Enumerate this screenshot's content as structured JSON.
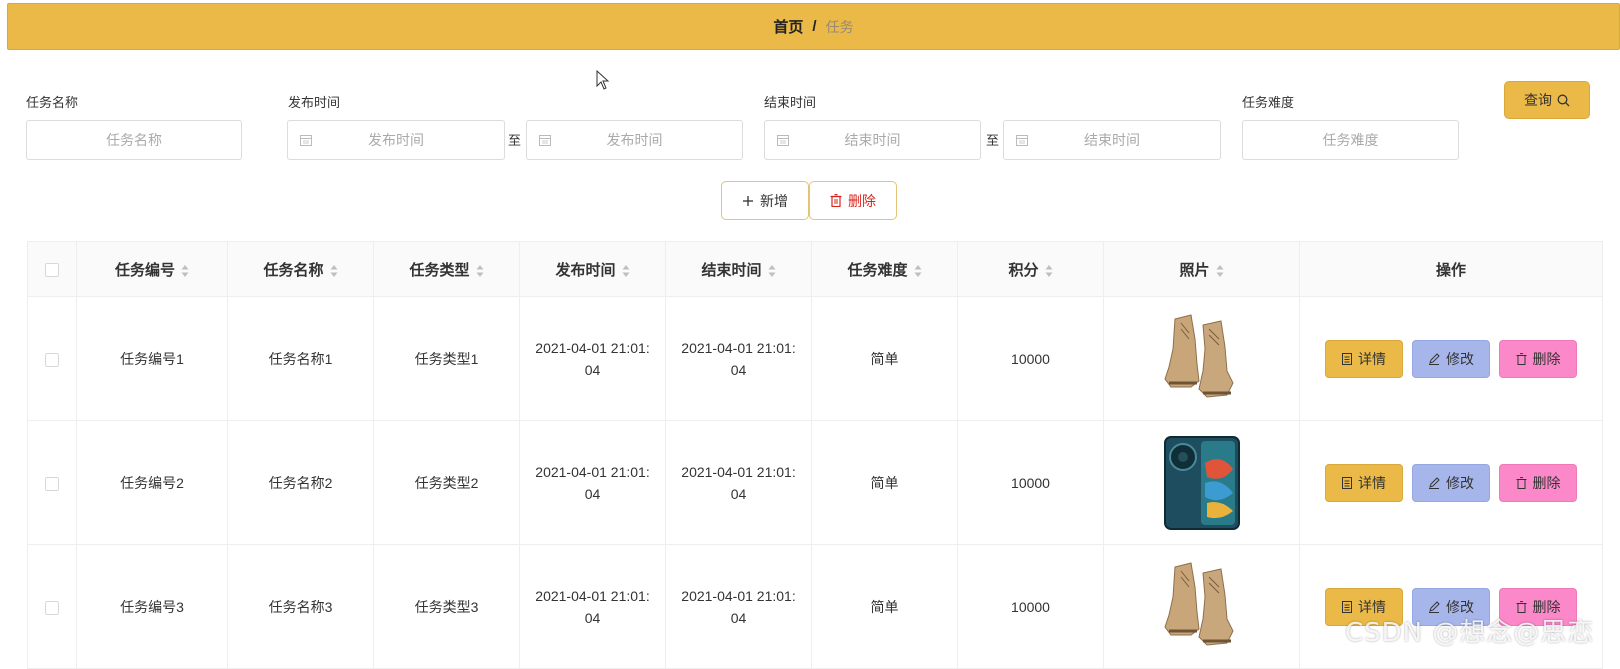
{
  "breadcrumb": {
    "home": "首页",
    "separator": "/",
    "current": "任务"
  },
  "filters": {
    "task_name": {
      "label": "任务名称",
      "placeholder": "任务名称"
    },
    "publish_time": {
      "label": "发布时间",
      "start_placeholder": "发布时间",
      "end_placeholder": "发布时间",
      "to": "至"
    },
    "end_time": {
      "label": "结束时间",
      "start_placeholder": "结束时间",
      "end_placeholder": "结束时间",
      "to": "至"
    },
    "difficulty": {
      "label": "任务难度",
      "placeholder": "任务难度"
    },
    "query_label": "查询"
  },
  "actions": {
    "add_label": "新增",
    "delete_label": "删除"
  },
  "table": {
    "columns": [
      "任务编号",
      "任务名称",
      "任务类型",
      "发布时间",
      "结束时间",
      "任务难度",
      "积分",
      "照片",
      "操作"
    ],
    "rows": [
      {
        "code": "任务编号1",
        "name": "任务名称1",
        "type": "任务类型1",
        "publish": "2021-04-01 21:01:04",
        "end": "2021-04-01 21:01:04",
        "difficulty": "简单",
        "points": "10000",
        "photo": "boots-image"
      },
      {
        "code": "任务编号2",
        "name": "任务名称2",
        "type": "任务类型2",
        "publish": "2021-04-01 21:01:04",
        "end": "2021-04-01 21:01:04",
        "difficulty": "简单",
        "points": "10000",
        "photo": "phone-image"
      },
      {
        "code": "任务编号3",
        "name": "任务名称3",
        "type": "任务类型3",
        "publish": "2021-04-01 21:01:04",
        "end": "2021-04-01 21:01:04",
        "difficulty": "简单",
        "points": "10000",
        "photo": "boots-image"
      }
    ],
    "row_actions": {
      "detail": "详情",
      "edit": "修改",
      "delete": "删除"
    }
  },
  "watermark": "CSDN @想念@思恋",
  "colors": {
    "primary": "#eab947",
    "edit": "#a7b6ea",
    "delete": "#fb88c8",
    "danger_text": "#d9241c"
  }
}
